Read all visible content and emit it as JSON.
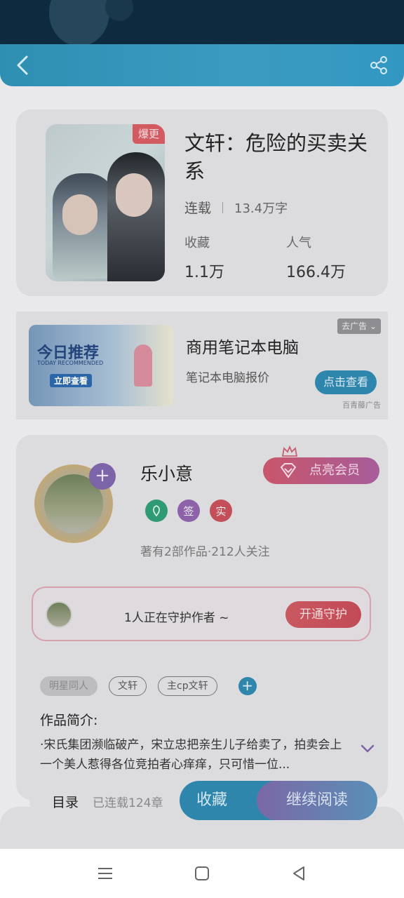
{
  "header": {
    "back_icon": "chevron-left-icon",
    "share_icon": "share-icon"
  },
  "book": {
    "cover_badge": "爆更",
    "title": "文轩：危险的买卖关系",
    "status": "连载",
    "words": "13.4万字",
    "fav_label": "收藏",
    "fav_value": "1.1万",
    "pop_label": "人气",
    "pop_value": "166.4万"
  },
  "ad": {
    "image_title": "今日推荐",
    "image_subtitle": "TODAY RECOMMENDED",
    "image_cta": "立即查看",
    "title": "商用笔记本电脑",
    "subtitle": "笔记本电脑报价",
    "close_label": "去广告",
    "button_label": "点击查看",
    "source": "百青藤广告"
  },
  "author": {
    "name": "乐小意",
    "plus": "+",
    "badge_sign": "签",
    "badge_real": "实",
    "stats": "著有2部作品·212人关注",
    "vip_label": "点亮会员",
    "guard_text": "1人正在守护作者 ~",
    "guard_button": "开通守护"
  },
  "tags": [
    "明星同人",
    "文轩",
    "主cp文轩"
  ],
  "tag_add": "+",
  "intro": {
    "title": "作品简介:",
    "text": "·宋氏集团濒临破产，宋立忠把亲生儿子给卖了，拍卖会上一个美人惹得各位竞拍者心痒痒，只可惜一位..."
  },
  "bottom": {
    "toc_label": "目录",
    "toc_count": "已连载124章",
    "fav_button": "收藏",
    "read_button": "继续阅读"
  },
  "colors": {
    "accent_blue": "#2f86ad",
    "accent_purple": "#7d63a8",
    "accent_red": "#c9585f"
  }
}
